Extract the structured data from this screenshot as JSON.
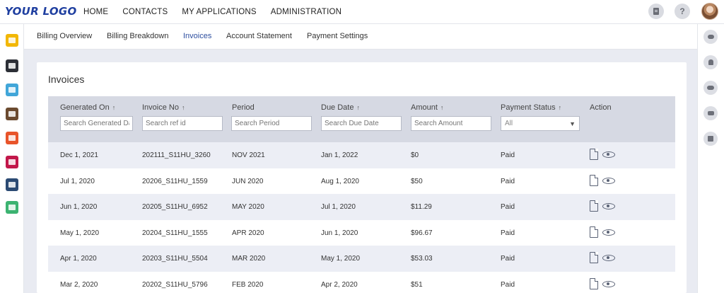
{
  "app": {
    "logo": "YOUR LOGO",
    "nav": [
      "HOME",
      "CONTACTS",
      "MY APPLICATIONS",
      "ADMINISTRATION"
    ],
    "help_label": "?"
  },
  "tabs": [
    "Billing Overview",
    "Billing Breakdown",
    "Invoices",
    "Account Statement",
    "Payment Settings"
  ],
  "active_tab": "Invoices",
  "invoices": {
    "title": "Invoices",
    "columns": {
      "generated_on": "Generated On",
      "invoice_no": "Invoice No",
      "period": "Period",
      "due_date": "Due Date",
      "amount": "Amount",
      "payment_status": "Payment Status",
      "action": "Action"
    },
    "sort_glyph": "↑",
    "filters": {
      "generated_on": "Search Generated Date",
      "invoice_no": "Search ref id",
      "period": "Search Period",
      "due_date": "Search Due Date",
      "amount": "Search Amount",
      "payment_status": "All"
    },
    "rows": [
      {
        "generated_on": "Dec 1, 2021",
        "invoice_no": "202111_S11HU_3260",
        "period": "NOV 2021",
        "due_date": "Jan 1, 2022",
        "amount": "$0",
        "status": "Paid"
      },
      {
        "generated_on": "Jul 1, 2020",
        "invoice_no": "20206_S11HU_1559",
        "period": "JUN 2020",
        "due_date": "Aug 1, 2020",
        "amount": "$50",
        "status": "Paid"
      },
      {
        "generated_on": "Jun 1, 2020",
        "invoice_no": "20205_S11HU_6952",
        "period": "MAY 2020",
        "due_date": "Jul 1, 2020",
        "amount": "$11.29",
        "status": "Paid"
      },
      {
        "generated_on": "May 1, 2020",
        "invoice_no": "20204_S11HU_1555",
        "period": "APR 2020",
        "due_date": "Jun 1, 2020",
        "amount": "$96.67",
        "status": "Paid"
      },
      {
        "generated_on": "Apr 1, 2020",
        "invoice_no": "20203_S11HU_5504",
        "period": "MAR 2020",
        "due_date": "May 1, 2020",
        "amount": "$53.03",
        "status": "Paid"
      },
      {
        "generated_on": "Mar 2, 2020",
        "invoice_no": "20202_S11HU_5796",
        "period": "FEB 2020",
        "due_date": "Apr 2, 2020",
        "amount": "$51",
        "status": "Paid"
      }
    ]
  },
  "left_apps": [
    {
      "name": "yellow-app-icon",
      "color": "#f2b705"
    },
    {
      "name": "dark-app-icon",
      "color": "#2c2f36"
    },
    {
      "name": "calendar-app-icon",
      "color": "#41a6d9"
    },
    {
      "name": "notes-app-icon",
      "color": "#6b4a2f"
    },
    {
      "name": "orange-app-icon",
      "color": "#e8542a"
    },
    {
      "name": "crimson-app-icon",
      "color": "#c2174a"
    },
    {
      "name": "link-app-icon",
      "color": "#2b4a73"
    },
    {
      "name": "green-check-app-icon",
      "color": "#3cb371"
    }
  ],
  "right_icons": [
    "chat-icon",
    "person-icon",
    "people-icon",
    "phone-icon",
    "calendar-check-icon"
  ]
}
